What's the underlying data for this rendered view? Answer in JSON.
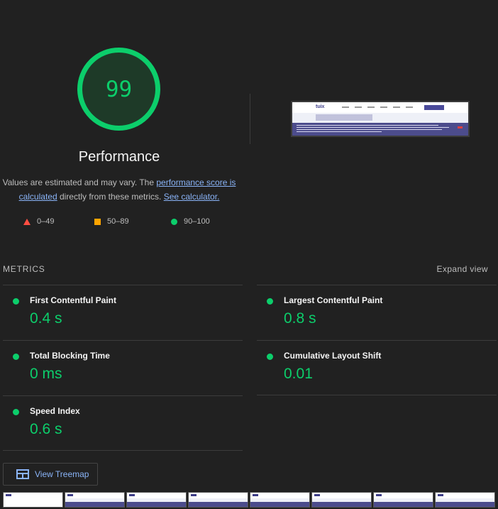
{
  "score": {
    "value": "99",
    "title": "Performance",
    "color": "#0cce6b"
  },
  "description": {
    "prefix": "Values are estimated and may vary. The ",
    "link1": "performance score is calculated",
    "middle": " directly from these metrics. ",
    "link2": "See calculator."
  },
  "legend": [
    {
      "icon": "triangle-icon",
      "label": "0–49",
      "color": "#ff4e42"
    },
    {
      "icon": "square-icon",
      "label": "50–89",
      "color": "#ffa400"
    },
    {
      "icon": "circle-icon",
      "label": "90–100",
      "color": "#0cce6b"
    }
  ],
  "metrics_section": {
    "header": "METRICS",
    "expand_label": "Expand view",
    "items": [
      {
        "label": "First Contentful Paint",
        "value": "0.4 s"
      },
      {
        "label": "Largest Contentful Paint",
        "value": "0.8 s"
      },
      {
        "label": "Total Blocking Time",
        "value": "0 ms"
      },
      {
        "label": "Cumulative Layout Shift",
        "value": "0.01"
      },
      {
        "label": "Speed Index",
        "value": "0.6 s"
      }
    ]
  },
  "treemap": {
    "label": "View Treemap",
    "icon": "treemap-icon"
  },
  "screenshot": {
    "logo": "tuix"
  }
}
